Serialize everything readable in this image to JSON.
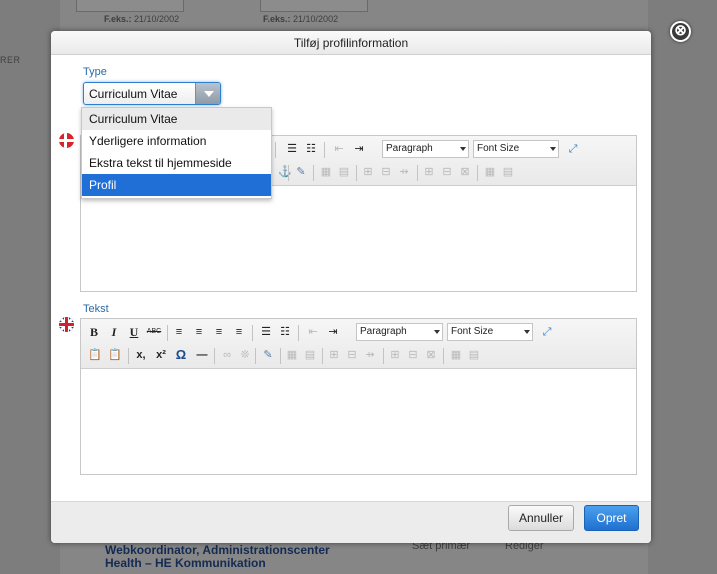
{
  "background": {
    "date_labels": [
      {
        "prefix": "F.eks.:",
        "value": "21/10/2002"
      },
      {
        "prefix": "F.eks.:",
        "value": "21/10/2002"
      }
    ],
    "left_text": "RER",
    "row_title_1": "Webkoordinator, Administrationscenter",
    "row_title_2": "Health – HE Kommunikation",
    "row_actions": [
      "Sæt primær",
      "Rediger"
    ]
  },
  "dialog": {
    "title": "Tilføj profilinformation",
    "close_symbol": "⊗",
    "type_label": "Type",
    "type_value": "Curriculum Vitae",
    "type_options": [
      "Curriculum Vitae",
      "Yderligere information",
      "Ekstra tekst til hjemmeside",
      "Profil"
    ],
    "highlighted_option": "Profil",
    "editor1_flag": "denmark-flag-icon",
    "editor2_label": "Tekst",
    "editor2_flag": "uk-flag-icon",
    "toolbar": {
      "bold": "B",
      "italic": "I",
      "underline": "U",
      "strike": "ABC",
      "format_select": "Paragraph",
      "fontsize_select": "Font Size",
      "subscript": "x,",
      "superscript": "x²",
      "omega": "Ω",
      "hr": "—"
    },
    "cancel_label": "Annuller",
    "create_label": "Opret"
  },
  "colors": {
    "accent": "#1f70cf",
    "label_blue": "#2c6aa6",
    "overlay": "#7d7d7d"
  }
}
